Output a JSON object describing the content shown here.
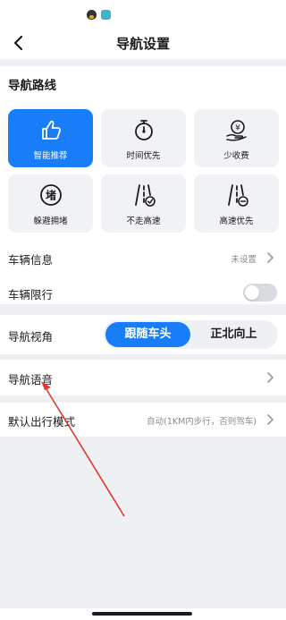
{
  "header": {
    "title": "导航设置"
  },
  "route": {
    "title": "导航路线",
    "options": [
      {
        "label": "智能推荐",
        "icon": "thumbs-up-icon",
        "active": true
      },
      {
        "label": "时间优先",
        "icon": "stopwatch-icon",
        "active": false
      },
      {
        "label": "少收费",
        "icon": "coin-hand-icon",
        "active": false
      },
      {
        "label": "躲避拥堵",
        "icon": "congestion-icon",
        "active": false
      },
      {
        "label": "不走高速",
        "icon": "no-highway-icon",
        "active": false
      },
      {
        "label": "高速优先",
        "icon": "highway-priority-icon",
        "active": false
      }
    ]
  },
  "vehicle": {
    "info_label": "车辆信息",
    "info_value": "未设置",
    "limit_label": "车辆限行",
    "limit_on": false
  },
  "view": {
    "label": "导航视角",
    "options": [
      "跟随车头",
      "正北向上"
    ],
    "selected": "跟随车头"
  },
  "voice": {
    "label": "导航语音"
  },
  "mode": {
    "label": "默认出行模式",
    "value": "自动(1KM内步行，否则驾车)"
  },
  "colors": {
    "accent": "#1a7df8",
    "annotation_arrow": "#e0392d"
  }
}
